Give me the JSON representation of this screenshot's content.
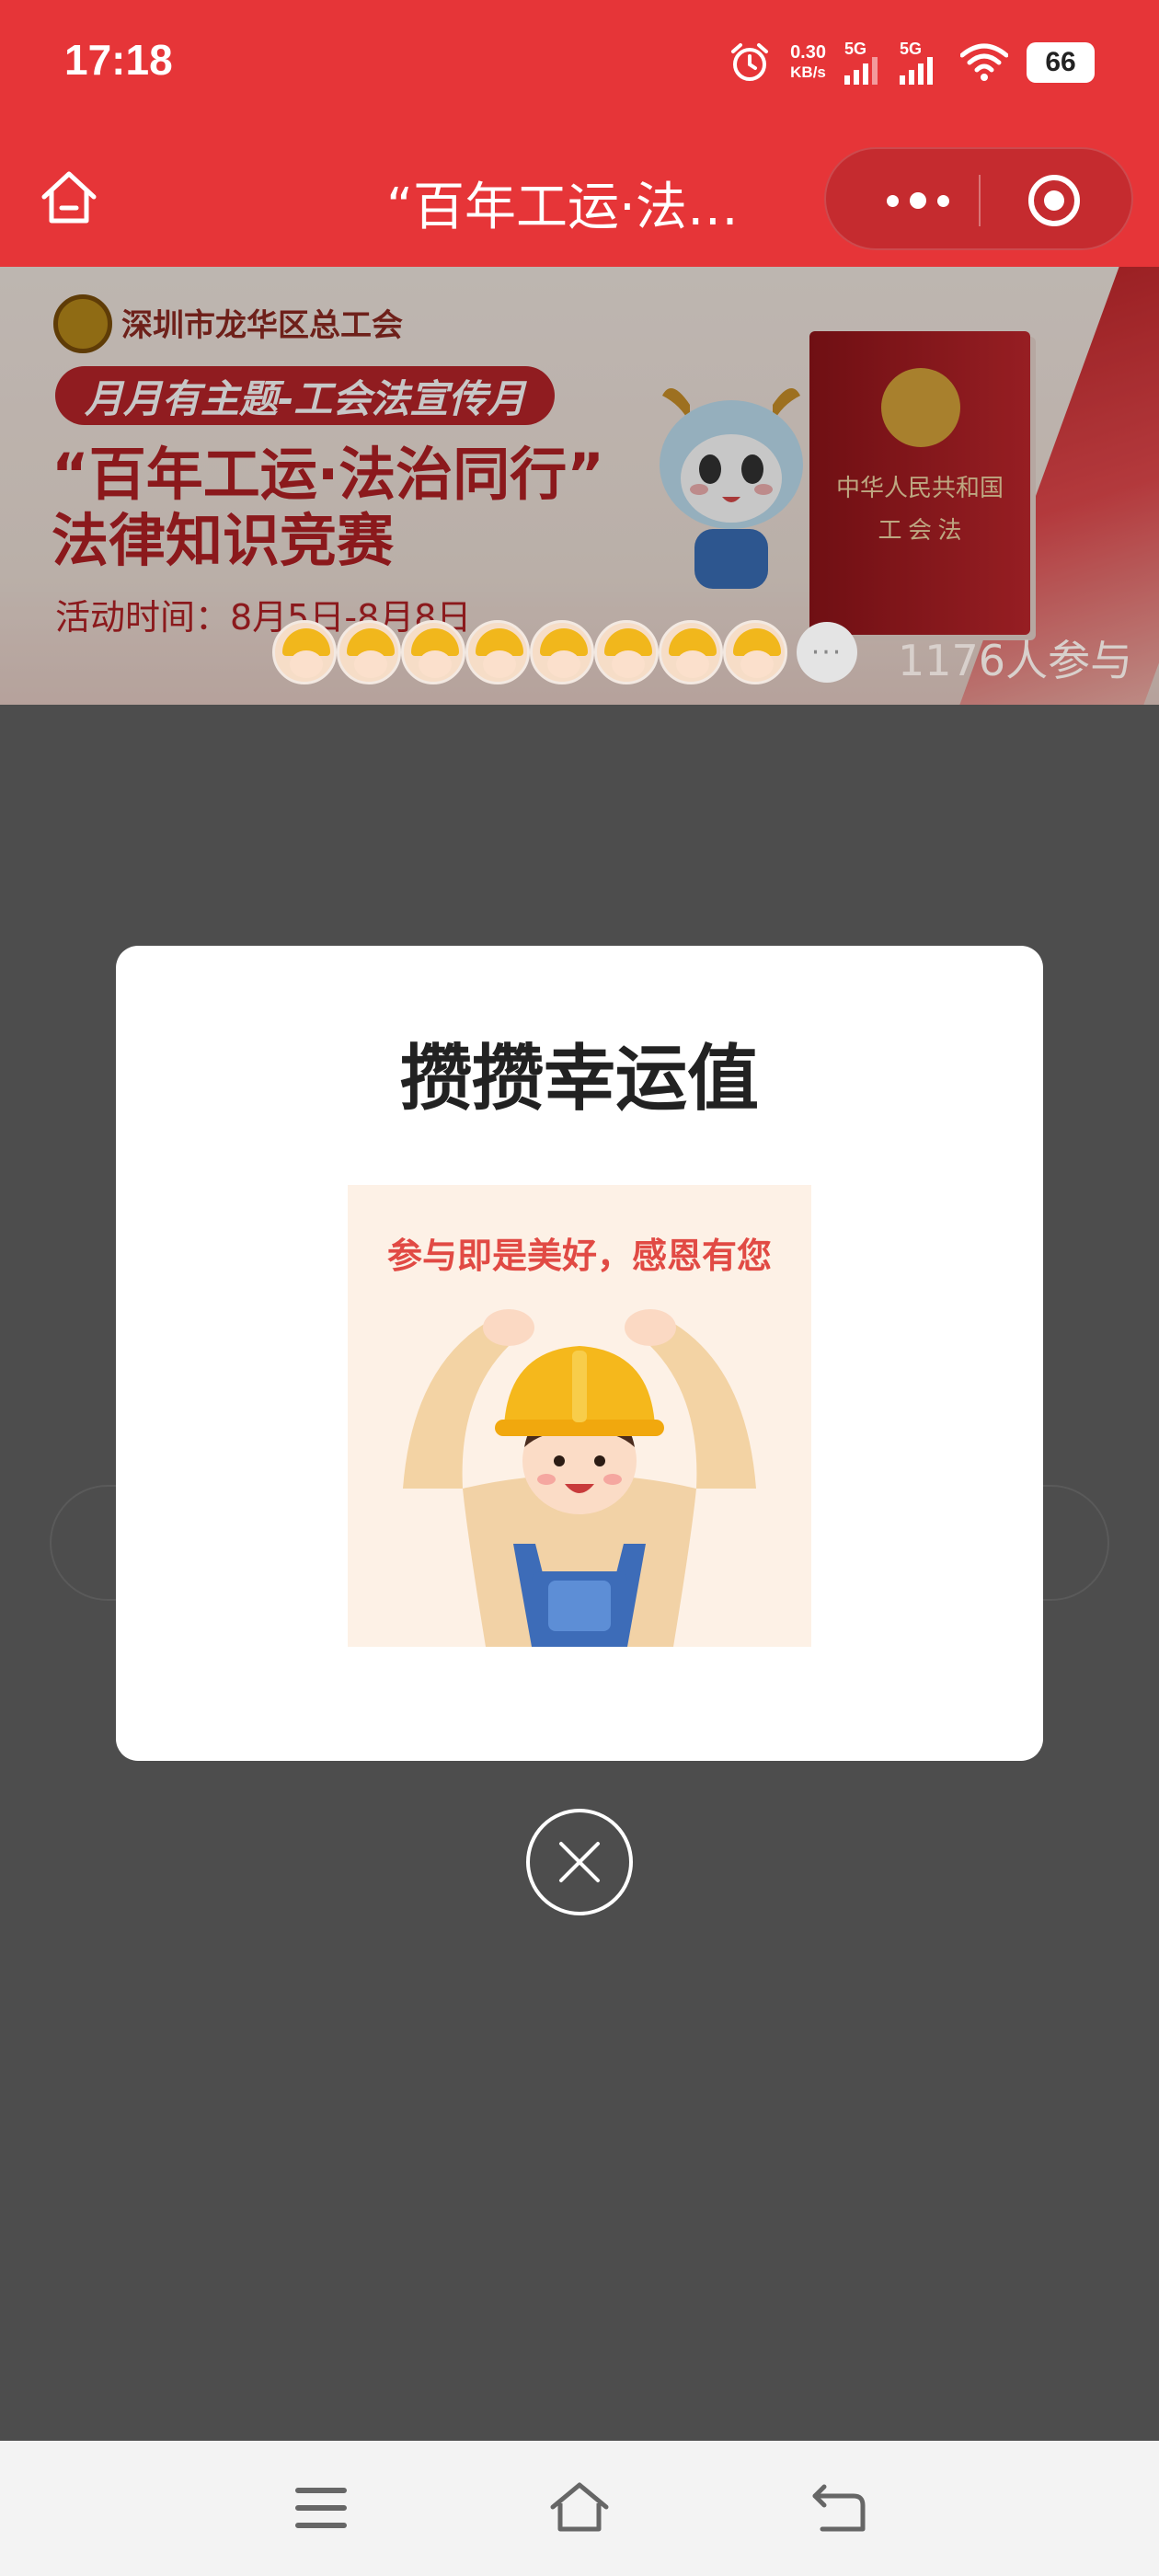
{
  "status_bar": {
    "time": "17:18",
    "net_speed_value": "0.30",
    "net_speed_unit": "KB/s",
    "sim1_label": "5G",
    "sim2_label": "5G",
    "battery": "66"
  },
  "nav_bar": {
    "title": "“百年工运·法…"
  },
  "banner": {
    "org_name": "深圳市龙华区总工会",
    "theme_pill": "月月有主题-工会法宣传月",
    "contest_title_line1": "“百年工运·法治同行”",
    "contest_title_line2": "法律知识竞赛",
    "activity_time": "活动时间：8月5日-8月8日",
    "book_title_line1": "中华人民共和国",
    "book_title_line2": "工 会 法",
    "avatar_more": "···",
    "participants": "1176人参与"
  },
  "modal": {
    "title": "攒攒幸运值",
    "image_caption": "参与即是美好，感恩有您"
  },
  "colors": {
    "brand_red": "#e63538",
    "capsule_red": "#c52b2f",
    "overlay": "#4d4d4d",
    "helmet_yellow": "#f5b81c"
  }
}
